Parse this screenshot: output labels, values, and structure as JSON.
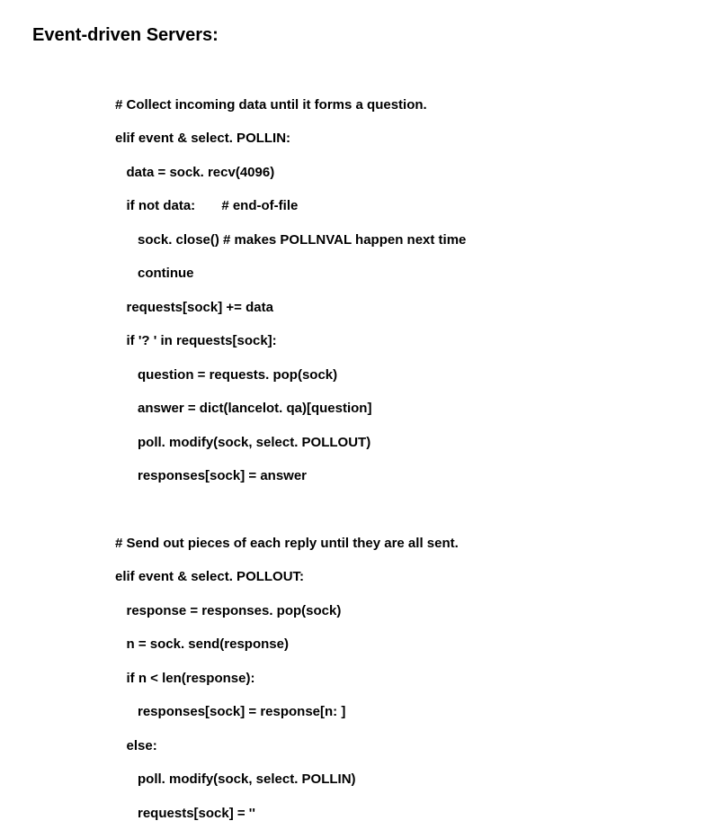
{
  "title": "Event-driven Servers:",
  "block1": {
    "l0": "# Collect incoming data until it forms a question.",
    "l1": "elif event & select. POLLIN:",
    "l2": "   data = sock. recv(4096)",
    "l3": "   if not data:       # end-of-file",
    "l4": "      sock. close() # makes POLLNVAL happen next time",
    "l5": "      continue",
    "l6": "   requests[sock] += data",
    "l7": "   if '? ' in requests[sock]:",
    "l8": "      question = requests. pop(sock)",
    "l9": "      answer = dict(lancelot. qa)[question]",
    "l10": "      poll. modify(sock, select. POLLOUT)",
    "l11": "      responses[sock] = answer"
  },
  "block2": {
    "l0": "# Send out pieces of each reply until they are all sent.",
    "l1": "elif event & select. POLLOUT:",
    "l2": "   response = responses. pop(sock)",
    "l3": "   n = sock. send(response)",
    "l4": "   if n < len(response):",
    "l5": "      responses[sock] = response[n: ]",
    "l6": "   else:",
    "l7": "      poll. modify(sock, select. POLLIN)",
    "l8": "      requests[sock] = ''"
  }
}
